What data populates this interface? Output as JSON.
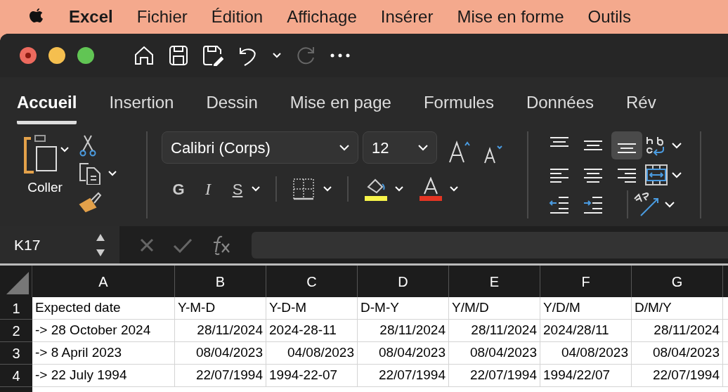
{
  "menu_bar": {
    "app": "Excel",
    "items": [
      "Fichier",
      "Édition",
      "Affichage",
      "Insérer",
      "Mise en forme",
      "Outils"
    ]
  },
  "tabs": [
    {
      "label": "Accueil",
      "selected": true
    },
    {
      "label": "Insertion",
      "selected": false
    },
    {
      "label": "Dessin",
      "selected": false
    },
    {
      "label": "Mise en page",
      "selected": false
    },
    {
      "label": "Formules",
      "selected": false
    },
    {
      "label": "Données",
      "selected": false
    },
    {
      "label": "Rév",
      "selected": false
    }
  ],
  "ribbon": {
    "paste_label": "Coller",
    "font": "Calibri (Corps)",
    "font_size": "12",
    "bold": "G",
    "italic": "I",
    "underline": "S",
    "vertical_align": [
      {
        "selected": false
      },
      {
        "selected": false
      },
      {
        "selected": true
      }
    ]
  },
  "name_box": "K17",
  "sheet": {
    "columns": [
      "A",
      "B",
      "C",
      "D",
      "E",
      "F",
      "G"
    ],
    "rows": [
      {
        "header": "1",
        "cells": [
          {
            "text": "Expected date",
            "kind": "text"
          },
          {
            "text": "Y-M-D",
            "kind": "text"
          },
          {
            "text": "Y-D-M",
            "kind": "text"
          },
          {
            "text": "D-M-Y",
            "kind": "text"
          },
          {
            "text": "Y/M/D",
            "kind": "text"
          },
          {
            "text": "Y/D/M",
            "kind": "text"
          },
          {
            "text": "D/M/Y",
            "kind": "text"
          }
        ]
      },
      {
        "header": "2",
        "cells": [
          {
            "text": "-> 28 October 2024",
            "kind": "text"
          },
          {
            "text": "28/11/2024",
            "kind": "date"
          },
          {
            "text": "2024-28-11",
            "kind": "text"
          },
          {
            "text": "28/11/2024",
            "kind": "date"
          },
          {
            "text": "28/11/2024",
            "kind": "date"
          },
          {
            "text": "2024/28/11",
            "kind": "text"
          },
          {
            "text": "28/11/2024",
            "kind": "date"
          }
        ]
      },
      {
        "header": "3",
        "cells": [
          {
            "text": "-> 8 April 2023",
            "kind": "text"
          },
          {
            "text": "08/04/2023",
            "kind": "date"
          },
          {
            "text": "04/08/2023",
            "kind": "date"
          },
          {
            "text": "08/04/2023",
            "kind": "date"
          },
          {
            "text": "08/04/2023",
            "kind": "date"
          },
          {
            "text": "04/08/2023",
            "kind": "date"
          },
          {
            "text": "08/04/2023",
            "kind": "date"
          }
        ]
      },
      {
        "header": "4",
        "cells": [
          {
            "text": "-> 22 July 1994",
            "kind": "text"
          },
          {
            "text": "22/07/1994",
            "kind": "date"
          },
          {
            "text": "1994-22-07",
            "kind": "text"
          },
          {
            "text": "22/07/1994",
            "kind": "date"
          },
          {
            "text": "22/07/1994",
            "kind": "date"
          },
          {
            "text": "1994/22/07",
            "kind": "text"
          },
          {
            "text": "22/07/1994",
            "kind": "date"
          }
        ]
      }
    ]
  }
}
